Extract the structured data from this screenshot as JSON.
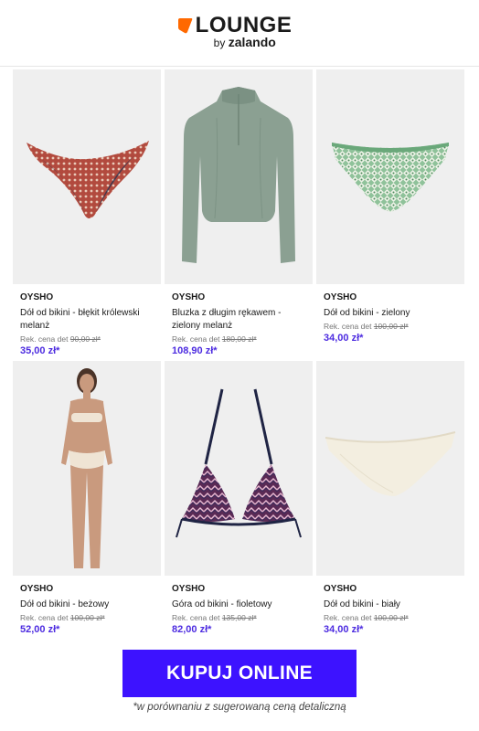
{
  "header": {
    "logo_word": "LOUNGE",
    "logo_by": "by",
    "logo_brand": "zalando"
  },
  "products": [
    {
      "brand": "OYSHO",
      "name": "Dół od bikini - błękit królewski melanż",
      "rek_label": "Rek. cena det",
      "old_price": "90,00 zł*",
      "price": "35,00 zł*",
      "image": "patterned-bikini-bottom"
    },
    {
      "brand": "OYSHO",
      "name": "Bluzka z długim rękawem - zielony melanż",
      "rek_label": "Rek. cena det",
      "old_price": "180,00 zł*",
      "price": "108,90 zł*",
      "image": "green-long-sleeve-top"
    },
    {
      "brand": "OYSHO",
      "name": "Dół od bikini - zielony",
      "rek_label": "Rek. cena det",
      "old_price": "100,00 zł*",
      "price": "34,00 zł*",
      "image": "green-bikini-bottom"
    },
    {
      "brand": "OYSHO",
      "name": "Dół od bikini - beżowy",
      "rek_label": "Rek. cena det",
      "old_price": "100,00 zł*",
      "price": "52,00 zł*",
      "image": "model-beige-bikini"
    },
    {
      "brand": "OYSHO",
      "name": "Góra od bikini - fioletowy",
      "rek_label": "Rek. cena det",
      "old_price": "135,00 zł*",
      "price": "82,00 zł*",
      "image": "purple-bikini-top"
    },
    {
      "brand": "OYSHO",
      "name": "Dół od bikini - biały",
      "rek_label": "Rek. cena det",
      "old_price": "100,00 zł*",
      "price": "34,00 zł*",
      "image": "white-bikini-bottom"
    }
  ],
  "cta": {
    "label": "KUPUJ ONLINE"
  },
  "footnote": "*w porównaniu z sugerowaną ceną detaliczną",
  "colors": {
    "accent": "#3d12ff",
    "price": "#4c2be0",
    "brand_orange": "#ff6900"
  }
}
